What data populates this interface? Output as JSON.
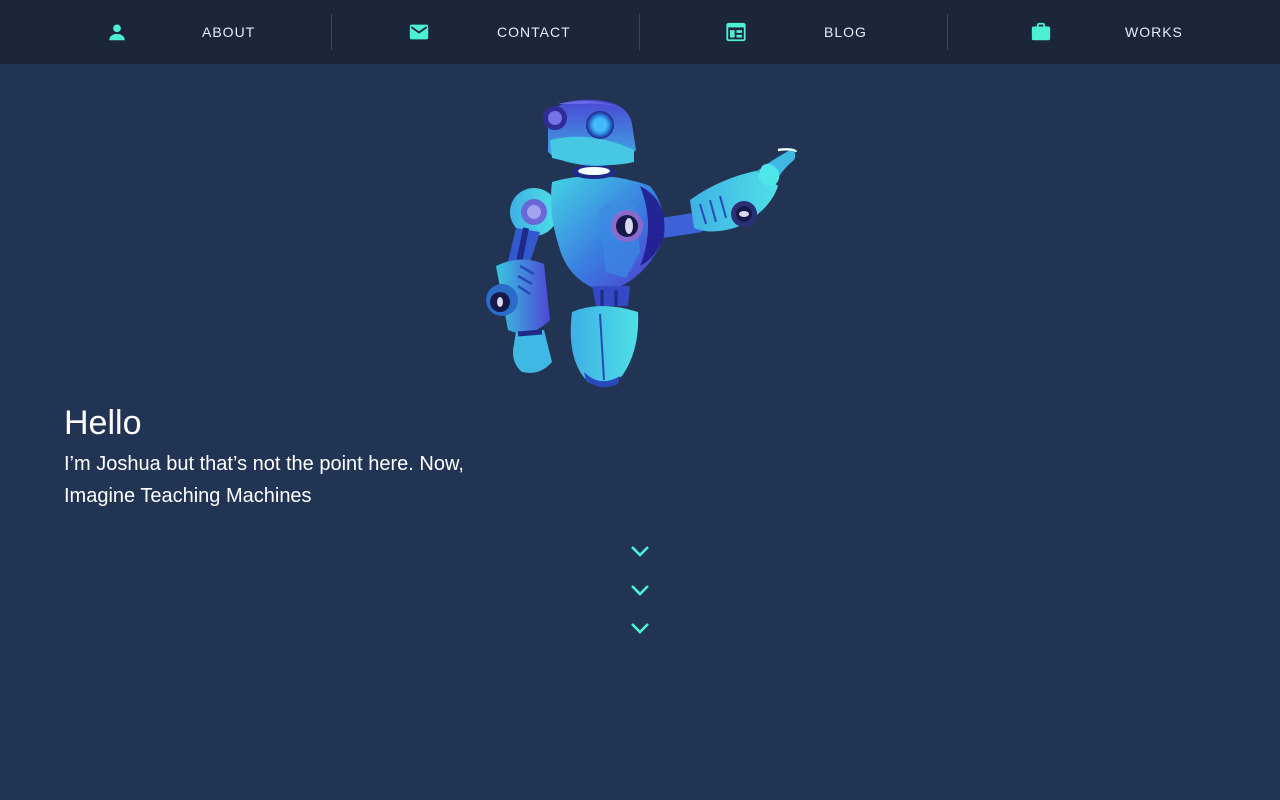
{
  "nav": {
    "items": [
      {
        "label": "ABOUT",
        "icon": "person-icon"
      },
      {
        "label": "CONTACT",
        "icon": "mail-icon"
      },
      {
        "label": "BLOG",
        "icon": "article-icon"
      },
      {
        "label": "WORKS",
        "icon": "briefcase-icon"
      }
    ]
  },
  "hero": {
    "greeting": "Hello",
    "line1": "I’m Joshua but that’s not the point here. Now,",
    "line2": "Imagine Teaching Machines",
    "illustration": "robot-pointing-illustration"
  },
  "scroll_hint": {
    "icon": "chevron-down-icon",
    "count": 3
  },
  "colors": {
    "page_bg": "#223454",
    "nav_bg": "#1c2639",
    "accent": "#4ef0d4",
    "text": "#ffffff"
  }
}
